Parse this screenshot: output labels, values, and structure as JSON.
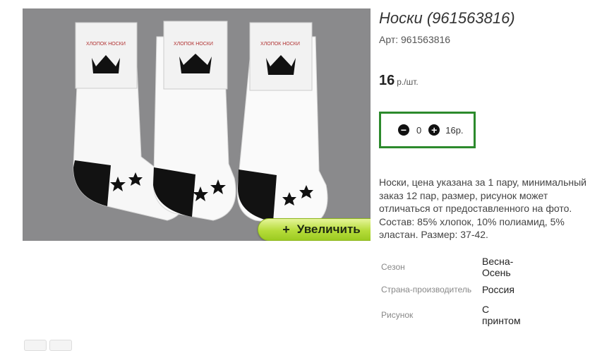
{
  "product": {
    "title": "Носки (961563816)",
    "sku": "Арт: 961563816",
    "price": "16",
    "price_unit": "р./шт.",
    "quantity": "0",
    "sum": "16р.",
    "zoom_label": "Увеличить",
    "zoom_icon": "+",
    "description": "Носки, цена указана за 1 пару, минимальный заказ 12 пар, размер, рисунок может отличаться от предоставленного на фото. Состав: 85% хлопок, 10% полиамид, 5% эластан. Размер: 37-42.",
    "properties": [
      {
        "label": "Сезон",
        "value": "Весна-Осень"
      },
      {
        "label": "Страна-производитель",
        "value": "Россия"
      },
      {
        "label": "Рисунок",
        "value": "С принтом"
      }
    ],
    "photo_label_text": "ХЛОПОК НОСКИ"
  },
  "colors": {
    "accent_green": "#2c8a2c",
    "zoom_button": "#b6dc3a",
    "photo_bg": "#8a8a8c"
  },
  "icons": [
    "minus-icon",
    "plus-icon"
  ]
}
